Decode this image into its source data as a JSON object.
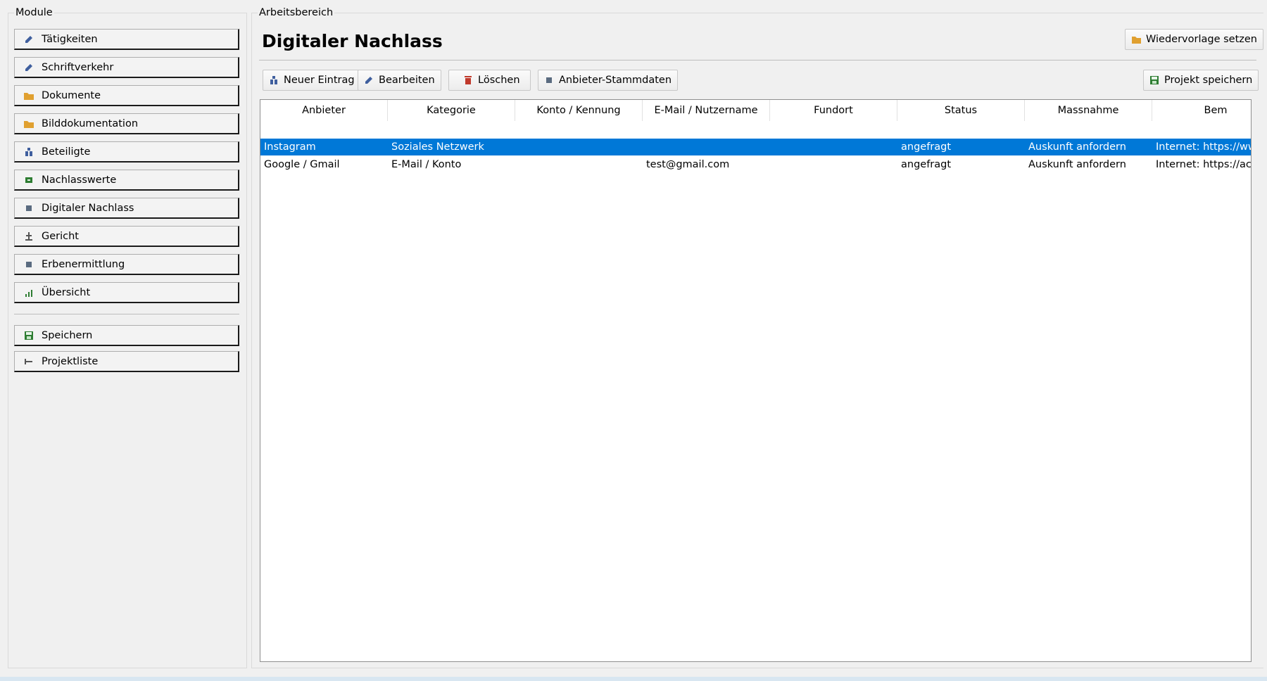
{
  "modules": {
    "title": "Module",
    "items": [
      {
        "label": "Tätigkeiten",
        "icon": "pencil-icon"
      },
      {
        "label": "Schriftverkehr",
        "icon": "pencil-icon"
      },
      {
        "label": "Dokumente",
        "icon": "folder-icon"
      },
      {
        "label": "Bilddokumentation",
        "icon": "folder-icon"
      },
      {
        "label": "Beteiligte",
        "icon": "people-icon"
      },
      {
        "label": "Nachlasswerte",
        "icon": "money-icon"
      },
      {
        "label": "Digitaler Nachlass",
        "icon": "square-icon"
      },
      {
        "label": "Gericht",
        "icon": "gavel-icon"
      },
      {
        "label": "Erbenermittlung",
        "icon": "square-icon"
      },
      {
        "label": "Übersicht",
        "icon": "bar-chart-icon"
      }
    ],
    "save_label": "Speichern",
    "projects_label": "Projektliste"
  },
  "workspace": {
    "title": "Arbeitsbereich",
    "heading": "Digitaler Nachlass",
    "reminder_label": "Wiedervorlage setzen",
    "toolbar": {
      "new_label": "Neuer Eintrag",
      "edit_label": "Bearbeiten",
      "delete_label": "Löschen",
      "provider_master_label": "Anbieter-Stammdaten",
      "save_project_label": "Projekt speichern"
    }
  },
  "table": {
    "columns": [
      "Anbieter",
      "Kategorie",
      "Konto / Kennung",
      "E-Mail / Nutzername",
      "Fundort",
      "Status",
      "Massnahme",
      "Bem"
    ],
    "rows": [
      {
        "cells": [
          "Instagram",
          "Soziales Netzwerk",
          "",
          "",
          "",
          "angefragt",
          "Auskunft anfordern",
          "Internet: https://ww"
        ],
        "selected": true
      },
      {
        "cells": [
          "Google / Gmail",
          "E-Mail / Konto",
          "",
          "test@gmail.com",
          "",
          "angefragt",
          "Auskunft anfordern",
          "Internet: https://acc"
        ],
        "selected": false
      }
    ]
  },
  "colors": {
    "selection": "#0078d7",
    "icon_blue": "#3f5f9e",
    "icon_folder": "#e0a030",
    "icon_green": "#2e7d32",
    "icon_red": "#c0392b"
  }
}
